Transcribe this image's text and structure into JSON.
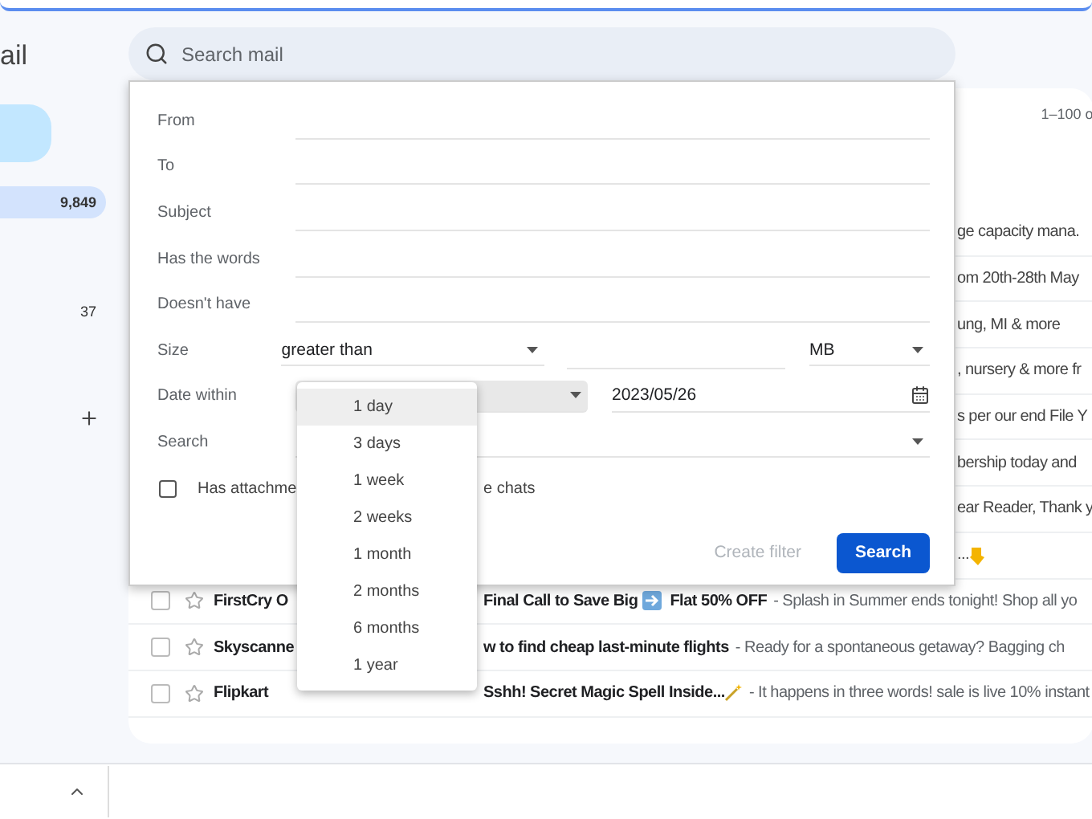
{
  "sidebar": {
    "title": "ail",
    "items": [
      {
        "count": "9,849",
        "selected": true
      },
      {
        "count": "37",
        "selected": false
      }
    ]
  },
  "search": {
    "placeholder": "Search mail"
  },
  "pagination": "1–100 o",
  "rows": [
    {
      "kind": "snippet",
      "snippet": "ge capacity mana."
    },
    {
      "kind": "snippet",
      "snippet": "om 20th-28th May"
    },
    {
      "kind": "snippet",
      "snippet": "ung, MI & more"
    },
    {
      "kind": "snippet",
      "snippet": ", nursery & more fr"
    },
    {
      "kind": "snippet",
      "snippet": "s per our end File Y"
    },
    {
      "kind": "snippet",
      "snippet": "bership today and"
    },
    {
      "kind": "snippet",
      "snippet": "ear Reader, Thank y"
    },
    {
      "kind": "pointer",
      "snippet": "..."
    },
    {
      "kind": "arrow",
      "sender": "FirstCry O",
      "subject": "Final Call to Save Big",
      "subject_tail": "Flat 50% OFF",
      "snippet": "- Splash in Summer ends tonight! Shop all yo",
      "checked": false,
      "starred": false
    },
    {
      "kind": "plain",
      "sender": "Skyscanne",
      "subject": "w to find cheap last-minute flights",
      "snippet": "- Ready for a spontaneous getaway? Bagging ch",
      "checked": false,
      "starred": false
    },
    {
      "kind": "wand",
      "sender": "Flipkart",
      "subject": "Sshh! Secret Magic Spell Inside...",
      "snippet": "- It happens in three words! sale is live 10% instant",
      "checked": false,
      "starred": false
    }
  ],
  "filter": {
    "fields": [
      {
        "kind": "text",
        "label": "From"
      },
      {
        "kind": "text",
        "label": "To"
      },
      {
        "kind": "text",
        "label": "Subject"
      },
      {
        "kind": "text",
        "label": "Has the words"
      },
      {
        "kind": "text",
        "label": "Doesn't have"
      },
      {
        "kind": "size",
        "label": "Size",
        "comparator": "greater than",
        "unit": "MB"
      },
      {
        "kind": "date",
        "label": "Date within",
        "date": "2023/05/26"
      },
      {
        "kind": "select",
        "label": "Search"
      }
    ],
    "attachment": {
      "label": "Has attachme",
      "checked": false
    },
    "chats_text": "e chats",
    "create_filter": {
      "label": "Create filter",
      "disabled": true
    },
    "search_button": "Search"
  },
  "dropdown": {
    "options": [
      {
        "label": "1 day",
        "selected": true
      },
      {
        "label": "3 days",
        "selected": false
      },
      {
        "label": "1 week",
        "selected": false
      },
      {
        "label": "2 weeks",
        "selected": false
      },
      {
        "label": "1 month",
        "selected": false
      },
      {
        "label": "2 months",
        "selected": false
      },
      {
        "label": "6 months",
        "selected": false
      },
      {
        "label": "1 year",
        "selected": false
      }
    ]
  }
}
